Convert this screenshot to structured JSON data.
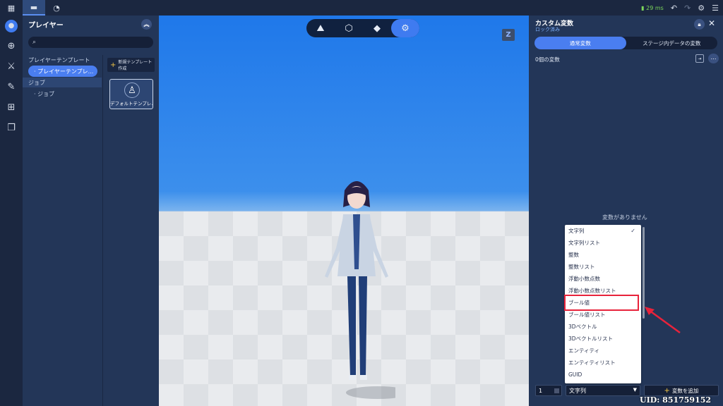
{
  "topbar": {
    "ping": "29 ms"
  },
  "player_panel": {
    "title": "プレイヤー",
    "search_placeholder": "",
    "tree": {
      "category_player_template": "プレイヤーテンプレート",
      "item_player_template": "プレイヤーテンプレ...",
      "category_job": "ジョブ",
      "item_job": "ジョブ"
    },
    "new_template_label": "新規テンプレート作成",
    "default_template_label": "デフォルトテンプレ..."
  },
  "viewport": {
    "z_key": "Z"
  },
  "custom_variables": {
    "title": "カスタム変数",
    "subtitle": "ロック済み",
    "tabs": [
      "通常変数",
      "ステージ内データの変数"
    ],
    "count_label": "0個の変数",
    "empty_label": "変数がありません",
    "quantity_value": "1",
    "selected_type": "文字列",
    "add_button_label": "変数を追加"
  },
  "type_dropdown": {
    "options": [
      "文字列",
      "文字列リスト",
      "整数",
      "整数リスト",
      "浮動小数点数",
      "浮動小数点数リスト",
      "ブール値",
      "ブール値リスト",
      "3Dベクトル",
      "3Dベクトルリスト",
      "エンティティ",
      "エンティティリスト",
      "GUID"
    ],
    "checked_index": 0,
    "highlighted_index": 6
  },
  "uid_label": "UID: 851759152",
  "colors": {
    "accent": "#4a7ef0",
    "panel": "#233658",
    "highlight": "#e8233b"
  }
}
